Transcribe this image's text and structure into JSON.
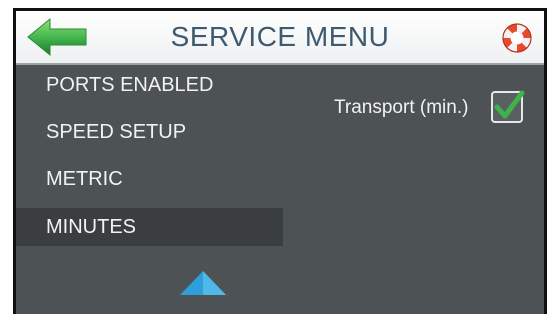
{
  "header": {
    "title": "SERVICE MENU",
    "back_icon": "arrow-left-icon",
    "help_icon": "lifebuoy-icon"
  },
  "menu": {
    "items": [
      {
        "label": "PORTS ENABLED",
        "selected": false
      },
      {
        "label": "SPEED SETUP",
        "selected": false
      },
      {
        "label": "METRIC",
        "selected": false
      },
      {
        "label": "MINUTES",
        "selected": true
      }
    ],
    "scroll_icon": "chevron-up-icon"
  },
  "options": {
    "transport": {
      "label": "Transport (min.)",
      "checked": true
    }
  },
  "colors": {
    "accent_green": "#3fb24a",
    "accent_blue": "#2e9fd8",
    "panel": "#4d5255",
    "selected_row": "#3a3e40",
    "title": "#3d5a70"
  }
}
